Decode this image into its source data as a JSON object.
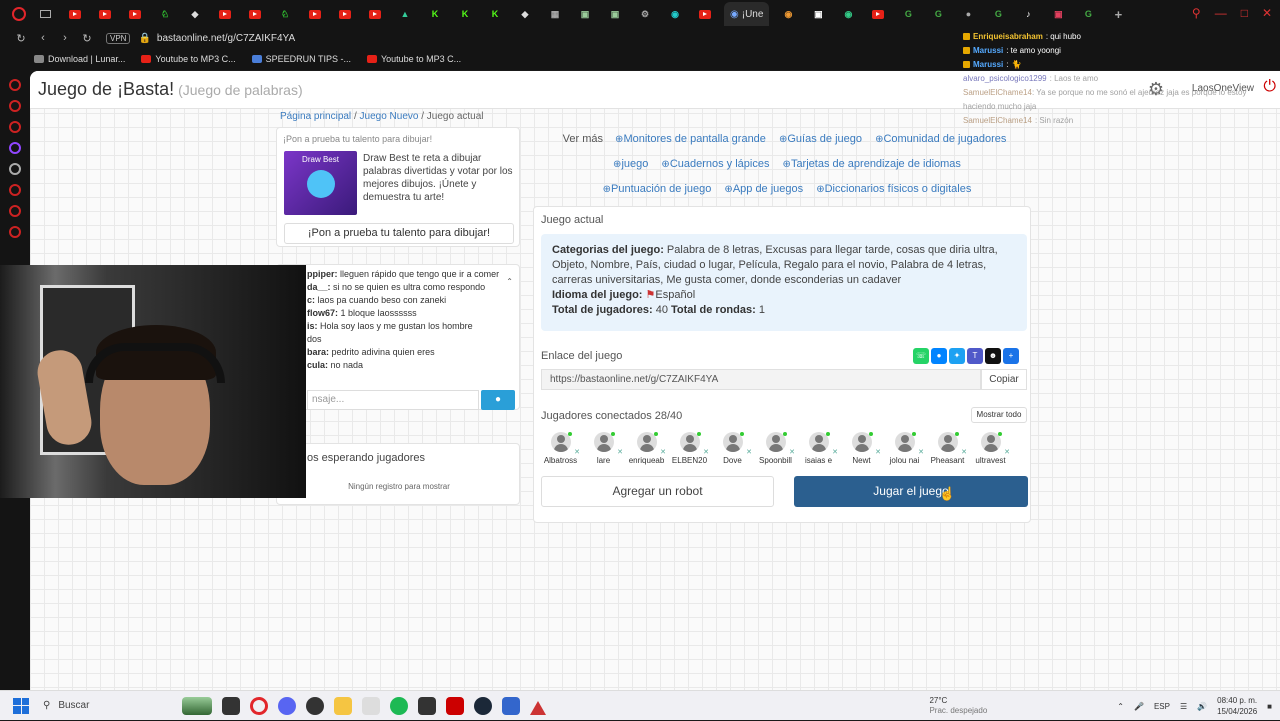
{
  "browser": {
    "active_tab_label": "¡Une",
    "url": "bastaonline.net/g/C7ZAIKF4YA",
    "vpn_label": "VPN",
    "bookmarks": [
      "Download | Lunar...",
      "Youtube to MP3 C...",
      "SPEEDRUN TIPS -...",
      "Youtube to MP3 C..."
    ]
  },
  "header": {
    "title": "Juego de ¡Basta!",
    "subtitle": "(Juego de palabras)",
    "user_name": "LaosOneView"
  },
  "breadcrumb": {
    "home": "Página principal",
    "new_game": "Juego Nuevo",
    "current": "Juego actual"
  },
  "promo": {
    "title": "¡Pon a prueba tu talento para dibujar!",
    "image_label": "Draw Best",
    "text": "Draw Best te reta a dibujar palabras divertidas y votar por los mejores dibujos. ¡Únete y demuestra tu arte!",
    "button_label": "¡Pon a prueba tu talento para dibujar!"
  },
  "chat": {
    "messages": [
      {
        "user": "ppiper:",
        "text": "lleguen rápido que tengo que ir a comer"
      },
      {
        "user": "da__:",
        "text": "si no se quien es ultra como respondo"
      },
      {
        "user": "c:",
        "text": "laos pa cuando beso con zaneki"
      },
      {
        "user": "flow67:",
        "text": "1 bloque laossssss"
      },
      {
        "user": "is:",
        "text": "Hola soy laos y me gustan los hombre"
      },
      {
        "user": "",
        "text": "dos"
      },
      {
        "user": "bara:",
        "text": "pedrito adivina quien eres"
      },
      {
        "user": "cula:",
        "text": "no nada"
      }
    ],
    "input_placeholder": "nsaje..."
  },
  "waiting": {
    "title": "os esperando jugadores",
    "empty_text": "Ningún registro para mostrar"
  },
  "related": {
    "label": "Ver más",
    "links": [
      "Monitores de pantalla grande",
      "Guías de juego",
      "Comunidad de jugadores",
      "juego",
      "Cuadernos y lápices",
      "Tarjetas de aprendizaje de idiomas",
      "Puntuación de juego",
      "App de juegos",
      "Diccionarios físicos o digitales"
    ]
  },
  "game": {
    "panel_title": "Juego actual",
    "categories_label": "Categorias del juego:",
    "categories_value": "Palabra de 8 letras, Excusas para llegar tarde, cosas que diria ultra, Objeto, Nombre, País, ciudad o lugar, Película, Regalo para el novio, Palabra de 4 letras, carreras universitarias, Me gusta comer, donde esconderias un cadaver",
    "language_label": "Idioma del juego:",
    "language_value": "Español",
    "players_total_label": "Total de jugadores:",
    "players_total_value": "40",
    "rounds_label": "Total de rondas:",
    "rounds_value": "1",
    "link_label": "Enlace del juego",
    "link_value": "https://bastaonline.net/g/C7ZAIKF4YA",
    "copy_label": "Copiar",
    "connected_label": "Jugadores conectados 28/40",
    "show_all_label": "Mostrar todo",
    "players": [
      "Albatross",
      "lare",
      "enriqueab",
      "ELBEN20",
      "Dove",
      "Spoonbill",
      "isaias e",
      "Newt",
      "jolou nai",
      "Pheasant",
      "ultravest"
    ],
    "add_robot_label": "Agregar un robot",
    "play_label": "Jugar el juego"
  },
  "stream_chat": [
    {
      "name": "Enriqueisabraham",
      "text": ": qui hubo",
      "dim": false
    },
    {
      "name": "Marussi",
      "text": ": te amo yoongi",
      "dim": false
    },
    {
      "name": "Marussi",
      "text": ":",
      "dim": false
    },
    {
      "name": "alvaro_psicologico1299",
      "text": ": Laos te amo",
      "dim": true
    },
    {
      "name": "SamuelElChame14",
      "text": ": Ya se porque no me sonó el ajedrez jaja es porque lo estoy haciendo mucho jaja",
      "dim": true
    },
    {
      "name": "SamuelElChame14",
      "text": ": Sin razón",
      "dim": true
    }
  ],
  "taskbar": {
    "search_label": "Buscar",
    "temperature": "27°C",
    "weather": "Prac. despejado",
    "language": "ESP",
    "time": "08:40 p. m.",
    "date": "15/04/2026"
  }
}
